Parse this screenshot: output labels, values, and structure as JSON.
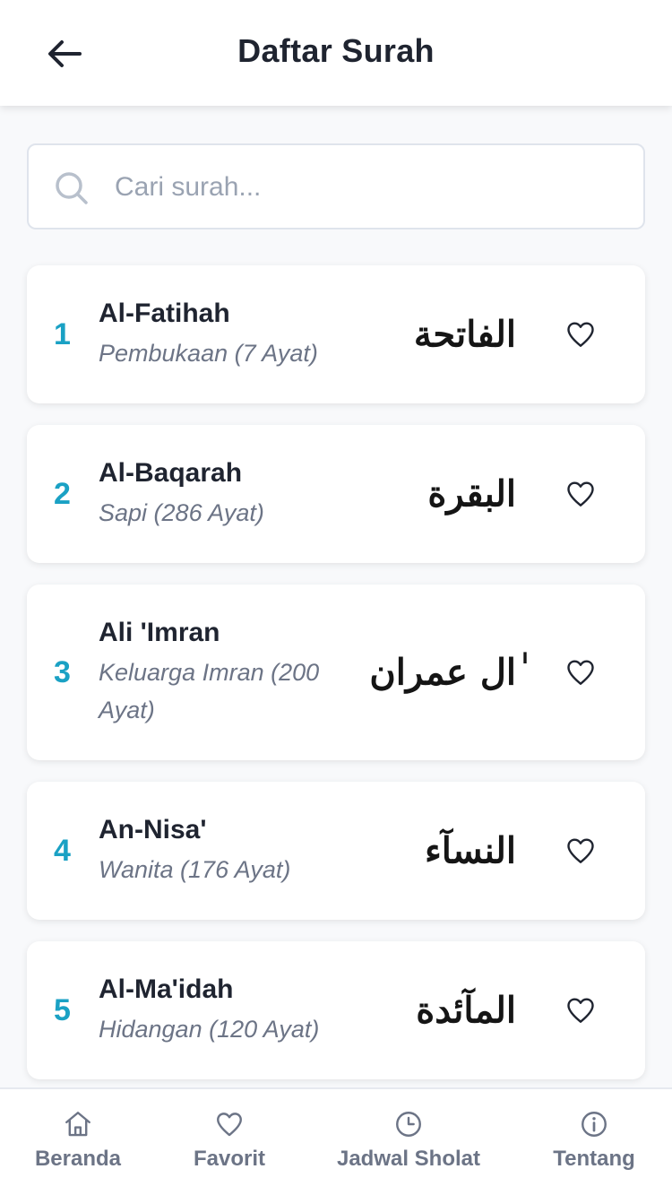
{
  "header": {
    "title": "Daftar Surah"
  },
  "search": {
    "placeholder": "Cari surah..."
  },
  "surahs": [
    {
      "number": "1",
      "name": "Al-Fatihah",
      "meaning": "Pembukaan (7 Ayat)",
      "arabic": "الفاتحة"
    },
    {
      "number": "2",
      "name": "Al-Baqarah",
      "meaning": "Sapi (286 Ayat)",
      "arabic": "البقرة"
    },
    {
      "number": "3",
      "name": "Ali 'Imran",
      "meaning": "Keluarga Imran (200 Ayat)",
      "arabic": "ٰال عمران"
    },
    {
      "number": "4",
      "name": "An-Nisa'",
      "meaning": "Wanita (176 Ayat)",
      "arabic": "النسآء"
    },
    {
      "number": "5",
      "name": "Al-Ma'idah",
      "meaning": "Hidangan (120 Ayat)",
      "arabic": "المآئدة"
    }
  ],
  "nav": {
    "items": [
      {
        "label": "Beranda",
        "icon": "home-icon"
      },
      {
        "label": "Favorit",
        "icon": "heart-icon"
      },
      {
        "label": "Jadwal Sholat",
        "icon": "clock-icon"
      },
      {
        "label": "Tentang",
        "icon": "info-icon"
      }
    ]
  },
  "colors": {
    "accent": "#1aa1c4",
    "text": "#1f2430",
    "muted": "#6c7486",
    "background": "#f8f9fb"
  }
}
